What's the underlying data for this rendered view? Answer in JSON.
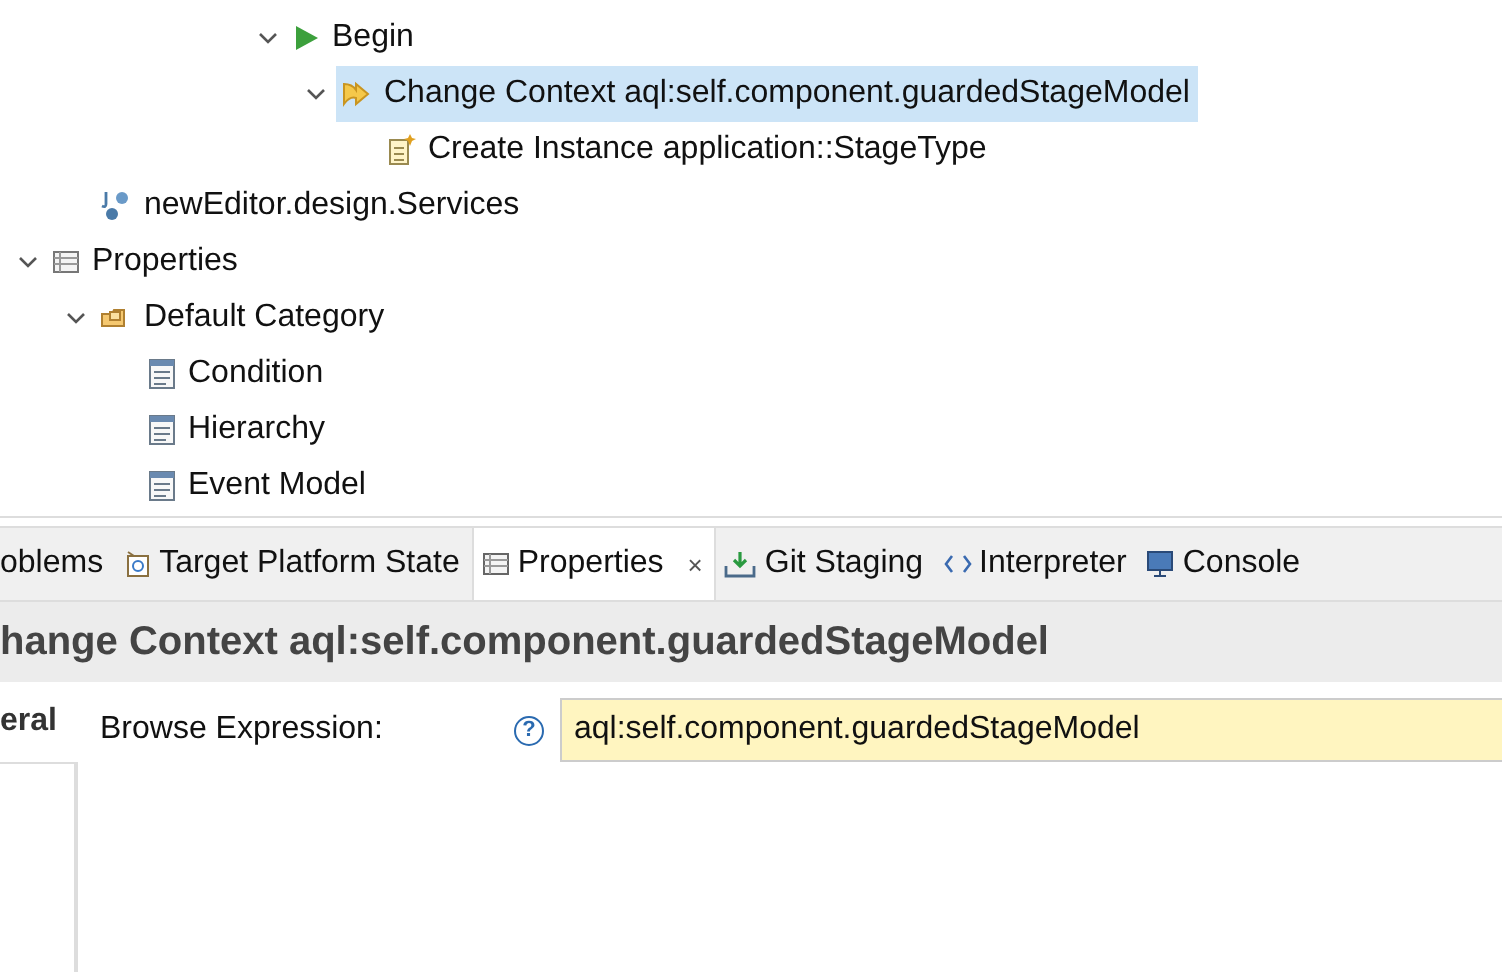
{
  "tree": [
    {
      "label": "Begin",
      "kind": "start",
      "expanded": true,
      "selected": false,
      "children": [
        {
          "label": "Change Context aql:self.component.guardedStageModel",
          "kind": "context",
          "expanded": true,
          "selected": true,
          "children": [
            {
              "label": "Create Instance application::StageType",
              "kind": "create",
              "selected": false
            }
          ]
        }
      ]
    },
    {
      "label": "newEditor.design.Services",
      "kind": "service",
      "selected": false
    },
    {
      "label": "Properties",
      "kind": "table",
      "expanded": true,
      "selected": false,
      "children": [
        {
          "label": "Default Category",
          "kind": "category",
          "expanded": true,
          "selected": false,
          "children": [
            {
              "label": "Condition",
              "kind": "page",
              "selected": false
            },
            {
              "label": "Hierarchy",
              "kind": "page",
              "selected": false
            },
            {
              "label": "Event Model",
              "kind": "page",
              "selected": false
            }
          ]
        }
      ]
    }
  ],
  "tabs": [
    {
      "label": "oblems",
      "kind": "problems",
      "selected": false
    },
    {
      "label": "Target Platform State",
      "kind": "target",
      "selected": false
    },
    {
      "label": "Properties",
      "kind": "table",
      "selected": true,
      "closable": true
    },
    {
      "label": "Git Staging",
      "kind": "git",
      "selected": false
    },
    {
      "label": "Interpreter",
      "kind": "interpreter",
      "selected": false
    },
    {
      "label": "Console",
      "kind": "console",
      "selected": false
    }
  ],
  "close_glyph": "×",
  "panel_title": "hange Context aql:self.component.guardedStageModel",
  "side_tabs": [
    {
      "label": "eral",
      "selected": true
    }
  ],
  "fields": [
    {
      "label": "Browse Expression:",
      "help": "?",
      "value": "aql:self.component.guardedStageModel"
    }
  ]
}
